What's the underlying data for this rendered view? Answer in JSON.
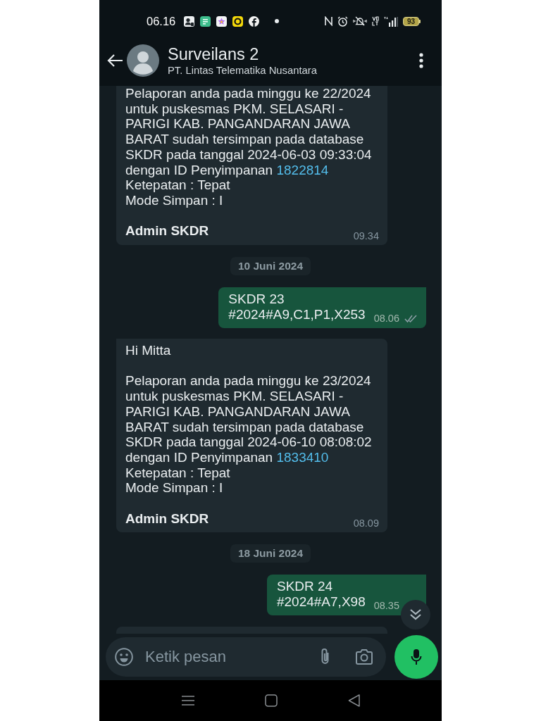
{
  "status_bar": {
    "time": "06.16",
    "battery": "93"
  },
  "header": {
    "title": "Surveilans 2",
    "subtitle": "PT. Lintas Telematika Nusantara"
  },
  "messages": [
    {
      "kind": "incoming",
      "report": {
        "text": "Pelaporan anda pada minggu ke 22/2024 untuk puskesmas PKM. SELASARI - PARIGI KAB. PANGANDARAN JAWA BARAT sudah tersimpan pada database SKDR pada tanggal 2024-06-03 09:33:04 dengan ID Penyimpanan",
        "id": "1822814"
      },
      "details": [
        "Ketepatan : Tepat",
        "Mode Simpan : I"
      ],
      "signature": "Admin SKDR",
      "time": "09.34"
    },
    {
      "kind": "date",
      "label": "10 Juni 2024"
    },
    {
      "kind": "outgoing",
      "tail": true,
      "text": "SKDR 23\n#2024#A9,C1,P1,X253",
      "time": "08.06",
      "read": false
    },
    {
      "kind": "incoming",
      "tail": true,
      "greeting": "Hi Mitta",
      "report": {
        "text": "Pelaporan anda pada minggu ke 23/2024 untuk puskesmas PKM. SELASARI - PARIGI KAB. PANGANDARAN JAWA BARAT sudah tersimpan pada database SKDR pada tanggal 2024-06-10 08:08:02 dengan ID Penyimpanan",
        "id": "1833410"
      },
      "details": [
        "Ketepatan : Tepat",
        "Mode Simpan : I"
      ],
      "signature": "Admin SKDR",
      "time": "08.09"
    },
    {
      "kind": "date",
      "label": "18 Juni 2024"
    },
    {
      "kind": "outgoing",
      "tail": true,
      "text": "SKDR 24\n#2024#A7,X98",
      "time": "08.35"
    },
    {
      "kind": "partial"
    }
  ],
  "composer": {
    "placeholder": "Ketik pesan"
  }
}
